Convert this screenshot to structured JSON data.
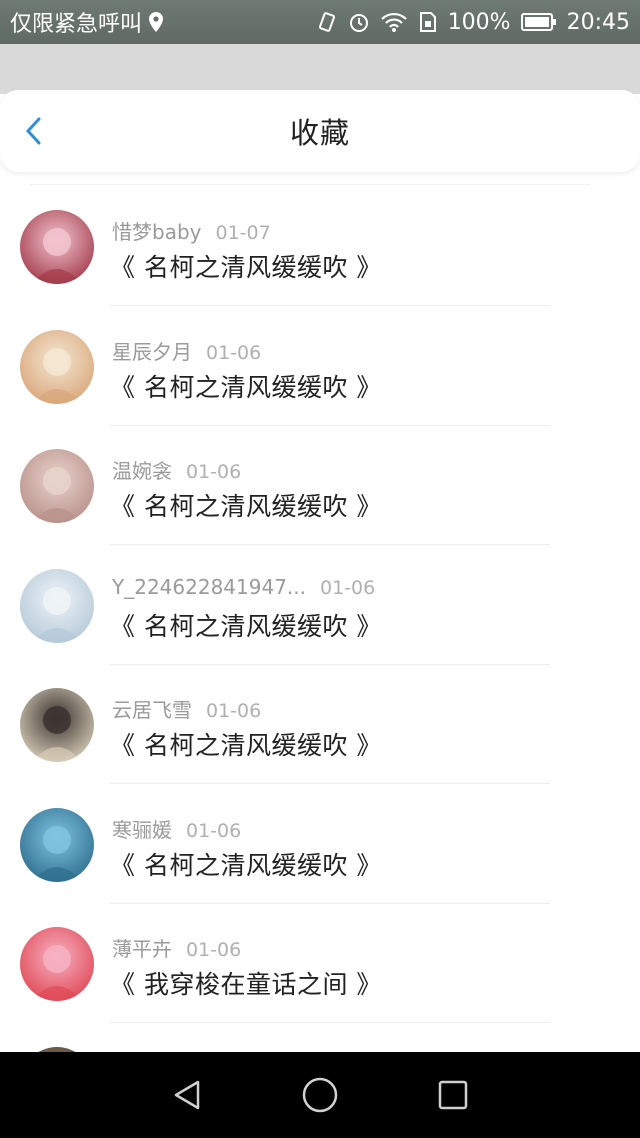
{
  "status_bar": {
    "carrier_text": "仅限紧急呼叫",
    "battery_percent": "100%",
    "time": "20:45"
  },
  "header": {
    "title": "收藏"
  },
  "items": [
    {
      "user": "惜梦baby",
      "date": "01-07",
      "title": "《 名柯之清风缓缓吹 》",
      "avatar_colors": [
        "#f2c4cf",
        "#a33a4a"
      ]
    },
    {
      "user": "星辰夕月",
      "date": "01-06",
      "title": "《 名柯之清风缓缓吹 》",
      "avatar_colors": [
        "#f4e7d2",
        "#d9a67a"
      ]
    },
    {
      "user": "温婉衾",
      "date": "01-06",
      "title": "《 名柯之清风缓缓吹 》",
      "avatar_colors": [
        "#e8d2cc",
        "#b8918a"
      ]
    },
    {
      "user": "Y_224622841947...",
      "date": "01-06",
      "title": "《 名柯之清风缓缓吹 》",
      "avatar_colors": [
        "#eef3f7",
        "#b5c9d8"
      ]
    },
    {
      "user": "云居飞雪",
      "date": "01-06",
      "title": "《 名柯之清风缓缓吹 》",
      "avatar_colors": [
        "#3a3330",
        "#d9cdb8"
      ]
    },
    {
      "user": "寒骊媛",
      "date": "01-06",
      "title": "《 名柯之清风缓缓吹 》",
      "avatar_colors": [
        "#7fc3e0",
        "#2e6e8e"
      ]
    },
    {
      "user": "薄平卉",
      "date": "01-06",
      "title": "《 我穿梭在童话之间 》",
      "avatar_colors": [
        "#f6b1c2",
        "#e04855"
      ]
    }
  ]
}
